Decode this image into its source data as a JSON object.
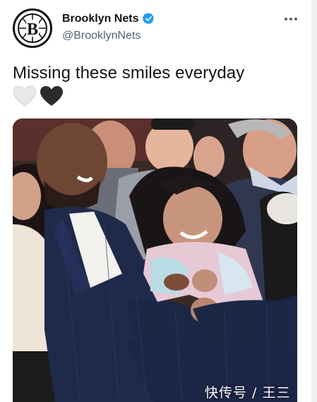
{
  "tweet": {
    "author": {
      "display_name": "Brooklyn Nets",
      "handle": "@BrooklynNets",
      "avatar_icon": "brooklyn-nets-logo",
      "verified_icon": "verified-badge-icon",
      "verified_color": "#1d9bf0"
    },
    "text": "Missing these smiles everyday",
    "emojis": [
      "white-heart-icon",
      "black-heart-icon"
    ],
    "more_icon": "more-options-icon"
  },
  "media": {
    "watermark": "快传号 / 王三"
  }
}
